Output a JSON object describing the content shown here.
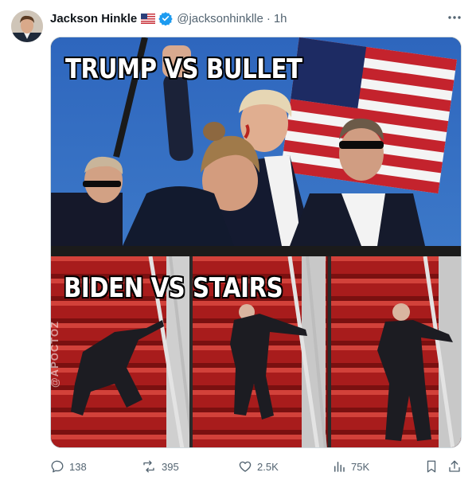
{
  "post": {
    "author_name": "Jackson Hinkle",
    "handle": "@jacksonhinklle",
    "separator": "·",
    "time": "1h",
    "flag_icon": "us-flag-icon",
    "verified_icon": "verified-badge-icon",
    "verified_color": "#1d9bf0"
  },
  "media": {
    "top_caption": "TRUMP VS BULLET",
    "bottom_caption": "BIDEN VS STAIRS",
    "watermark": "@APOCTOZ"
  },
  "actions": {
    "replies": "138",
    "reposts": "395",
    "likes": "2.5K",
    "views": "75K"
  },
  "colors": {
    "text_primary": "#0f1419",
    "text_secondary": "#536471",
    "stair_red": "#b51f1f",
    "sky_blue": "#2c63b8"
  }
}
